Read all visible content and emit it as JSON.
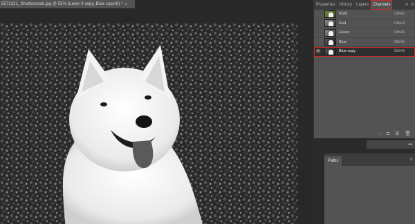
{
  "document": {
    "tab_title": "5571321_Shutterstock.jpg @ 55% (Layer 0 copy, Blue copy/8) *",
    "close_glyph": "×"
  },
  "panel": {
    "tabs": [
      "Properties",
      "History",
      "Layers",
      "Channels"
    ],
    "active_tab": "Channels",
    "collapse_glyph": "»",
    "menu_glyph": "≡"
  },
  "channels": [
    {
      "name": "RGB",
      "shortcut": "Ctrl+2",
      "visible": false,
      "thumb": "color"
    },
    {
      "name": "Red",
      "shortcut": "Ctrl+3",
      "visible": false,
      "thumb": "gray"
    },
    {
      "name": "Green",
      "shortcut": "Ctrl+4",
      "visible": false,
      "thumb": "gray"
    },
    {
      "name": "Blue",
      "shortcut": "Ctrl+5",
      "visible": false,
      "thumb": "dark"
    },
    {
      "name": "Blue copy",
      "shortcut": "Ctrl+6",
      "visible": true,
      "thumb": "dark",
      "selected": true
    }
  ],
  "footer_icons": [
    "load-selection-icon",
    "save-selection-icon",
    "new-channel-icon",
    "delete-channel-icon"
  ],
  "paths": {
    "tab_label": "Paths",
    "menu_glyph": "≡",
    "dock_arrows": "◂◂"
  },
  "colors": {
    "highlight": "#d42a2a",
    "panel_bg": "#535353",
    "app_bg": "#282828"
  }
}
